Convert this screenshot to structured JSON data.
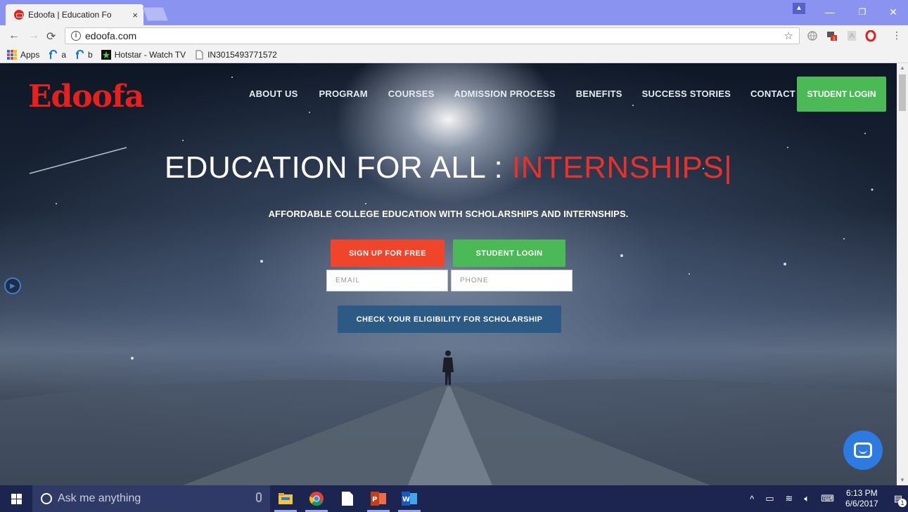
{
  "browser": {
    "tab_title": "Edoofa | Education Fo",
    "tab_close": "×",
    "url": "edoofa.com",
    "profile_badge": "▲",
    "window_controls": [
      "—",
      "❐",
      "✕"
    ]
  },
  "bookmarks": [
    {
      "label": "Apps",
      "icon": "apps-grid-icon"
    },
    {
      "label": "a",
      "icon": "bookmark-a-icon"
    },
    {
      "label": "b",
      "icon": "bookmark-b-icon"
    },
    {
      "label": "Hotstar - Watch TV",
      "icon": "hotstar-icon"
    },
    {
      "label": "IN3015493771572",
      "icon": "page-icon"
    }
  ],
  "site": {
    "logo": "Edoofa",
    "nav": [
      "ABOUT US",
      "PROGRAM",
      "COURSES",
      "ADMISSION PROCESS",
      "BENEFITS",
      "SUCCESS STORIES",
      "CONTACT US"
    ],
    "top_login": "STUDENT LOGIN",
    "headline_main": "EDUCATION FOR ALL : ",
    "headline_accent": "INTERNSHIPS|",
    "subline": "AFFORDABLE COLLEGE EDUCATION WITH SCHOLARSHIPS AND INTERNSHIPS.",
    "signup_label": "SIGN UP FOR FREE",
    "login_label": "STUDENT LOGIN",
    "email_placeholder": "EMAIL",
    "phone_placeholder": "PHONE",
    "eligibility_label": "CHECK YOUR ELIGIBILITY FOR SCHOLARSHIP",
    "colors": {
      "brand_red": "#e8201d",
      "signup": "#f0452b",
      "login_green": "#4cb957",
      "eligibility_blue": "#2c5a84",
      "chat_blue": "#2d7ae1"
    }
  },
  "taskbar": {
    "search_placeholder": "Ask me anything",
    "apps": [
      "file-explorer-icon",
      "chrome-icon",
      "notepad-icon",
      "powerpoint-icon",
      "word-icon"
    ],
    "time": "6:13 PM",
    "date": "6/6/2017",
    "notification_count": "1"
  }
}
